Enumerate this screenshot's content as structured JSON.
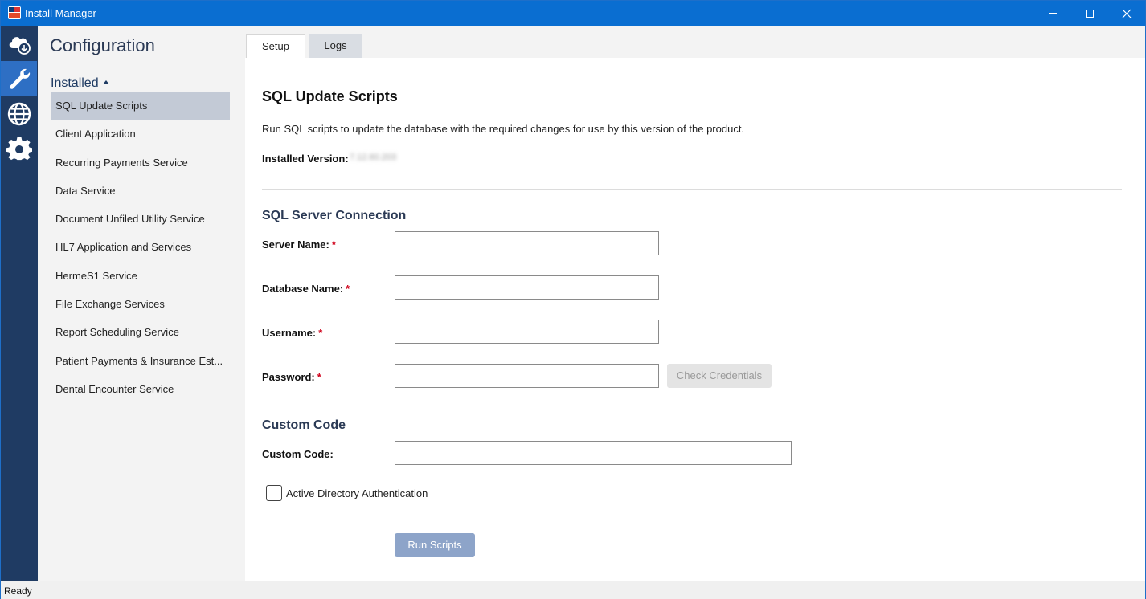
{
  "window": {
    "title": "Install Manager",
    "accent_color": "#0a6ed1",
    "controls": [
      "minimize-icon",
      "maximize-icon",
      "close-icon"
    ]
  },
  "rail": {
    "items": [
      {
        "icon": "cloud-download-icon",
        "active": false
      },
      {
        "icon": "wrench-icon",
        "active": true
      },
      {
        "icon": "globe-icon",
        "active": false
      },
      {
        "icon": "gear-icon",
        "active": false
      }
    ],
    "color": "#1f3b63",
    "active_color": "#2e6fc4"
  },
  "nav": {
    "title": "Configuration",
    "section": "Installed",
    "items": [
      "SQL Update Scripts",
      "Client Application",
      "Recurring Payments Service",
      "Data Service",
      "Document Unfiled Utility Service",
      "HL7 Application and Services",
      "HermeS1 Service",
      "File Exchange Services",
      "Report Scheduling Service",
      "Patient Payments & Insurance Est...",
      "Dental Encounter Service"
    ],
    "selected_index": 0
  },
  "tabs": [
    "Setup",
    "Logs"
  ],
  "active_tab": "Setup",
  "content": {
    "heading": "SQL Update Scripts",
    "description": "Run SQL scripts to update the database with the required changes for use by this version of the product.",
    "installed_version_label": "Installed Version:",
    "installed_version_value": "7.12.60.203",
    "connection_heading": "SQL Server Connection",
    "server_name_label": "Server Name:",
    "database_name_label": "Database Name:",
    "username_label": "Username:",
    "password_label": "Password:",
    "required_marker": "*",
    "server_name_value": "",
    "database_name_value": "",
    "username_value": "",
    "password_value": "",
    "check_credentials_label": "Check Credentials",
    "custom_code_heading": "Custom Code",
    "custom_code_label": "Custom Code:",
    "custom_code_value": "",
    "ad_auth_label": "Active Directory Authentication",
    "ad_auth_checked": false,
    "run_scripts_label": "Run Scripts"
  },
  "status": {
    "text": "Ready"
  }
}
